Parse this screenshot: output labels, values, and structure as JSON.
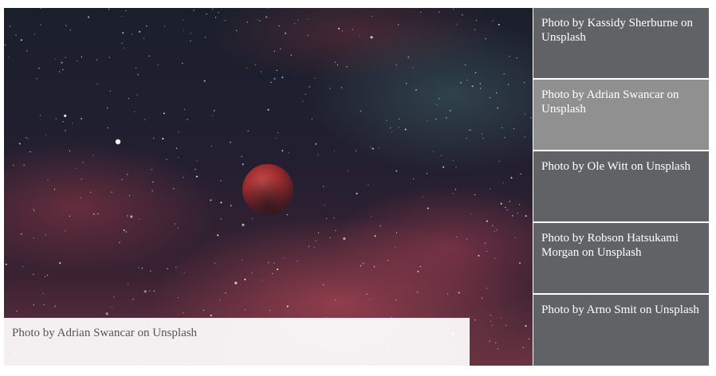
{
  "slider": {
    "main_caption": "Photo by Adrian Swancar on Unsplash",
    "active_index": 1,
    "thumbnails": [
      {
        "caption": "Photo by Kassidy Sherburne on Unsplash"
      },
      {
        "caption": "Photo by Adrian Swancar on Unsplash"
      },
      {
        "caption": "Photo by Ole Witt on Unsplash"
      },
      {
        "caption": "Photo by Robson Hatsukami Morgan on Unsplash"
      },
      {
        "caption": "Photo by Arno Smit on Unsplash"
      }
    ]
  },
  "colors": {
    "thumb_bg": "#616266",
    "thumb_active_bg": "#909090",
    "caption_bg": "#ffffff",
    "caption_text": "#555555"
  }
}
